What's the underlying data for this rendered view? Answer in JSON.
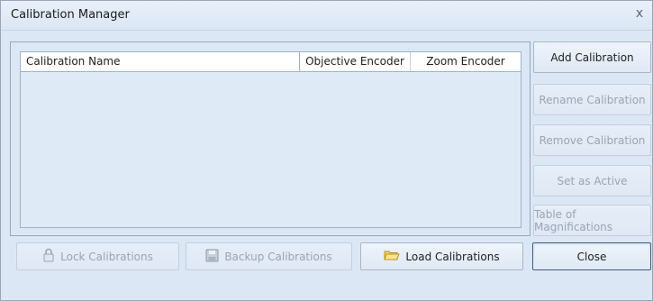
{
  "window": {
    "title": "Calibration Manager",
    "close_glyph": "x"
  },
  "grid": {
    "columns": [
      "Calibration Name",
      "Objective Encoder",
      "Zoom Encoder"
    ],
    "rows": []
  },
  "side_buttons": {
    "add": "Add Calibration",
    "rename": "Rename Calibration",
    "remove": "Remove Calibration",
    "set_active": "Set as Active",
    "table": "Table of Magnifications"
  },
  "bottom_buttons": {
    "lock": "Lock Calibrations",
    "backup": "Backup Calibrations",
    "load": "Load Calibrations",
    "close": "Close"
  },
  "icons": {
    "lock": "padlock-icon",
    "backup": "floppy-disk-icon",
    "load": "open-folder-icon",
    "close": "close-icon"
  }
}
